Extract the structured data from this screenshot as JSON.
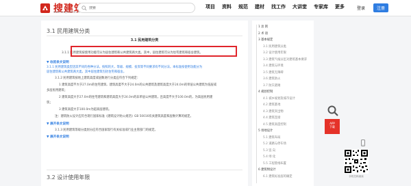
{
  "header": {
    "logo_text": "搜建筑",
    "logo_sub": "www.soujianzhu.cn",
    "search_placeholder": "搜索",
    "nav": [
      "项目",
      "资料",
      "规范",
      "建材",
      "找工作",
      "大讲堂",
      "专家库",
      "更多"
    ],
    "login_label": "登录",
    "register_label": "注册"
  },
  "main": {
    "section_title": "3.1 民用建筑分类",
    "sub_title": "3.1 民用建筑分类",
    "clause_311": "3.1.1 民用建筑按使用功能可分为居住建筑和公共建筑两大类。其中，居住建筑可分为住宅建筑和宿舍建筑。",
    "toggle_1": "▼ 收起条文说明",
    "explain_1a": "3.1.1 民用建筑类型因其不同的各种分法，按照的大，等级、规模、投资等不同要求有不同分法，本标准按使用功能分为",
    "explain_1b": "居住建筑和公共建筑两大类，其中居住建筑包括住宅和宿舍。",
    "clause_312": "3.1.2 民用建筑按地上建筑高度或层数进行分类应符合下列规定：",
    "item_1a": "1 建筑高度不大于27.0m的住宅建筑、建筑高度不大于24.0m的公共建筑及建筑高度大于24.0m的单层公共建筑为低层或",
    "item_1b": "多层民用建筑；",
    "item_2a": "2 建筑高度大于27.0m的住宅建筑和建筑高度大于24.0m的非单层公共建筑，且高度不大于100.0m的，为高层民用建",
    "item_2b": "筑；",
    "item_3": "3 建筑高度大于100.0m为超高层建筑。",
    "note": "注：建筑防火设计应符合现行国家标准《建筑设计防火规范》GB 50016有关建筑高度和层数计算的规定。",
    "toggle_2": "▼ 展开条文说明",
    "clause_313": "3.1.3 民用建筑等级分类划分应符合国家现行有关标准或行业主管部门的规定。",
    "toggle_3": "▼ 展开条文说明",
    "next_section": "3.2 设计使用年限"
  },
  "toc": [
    {
      "label": "1 总 则",
      "level": 1
    },
    {
      "label": "2 术 语",
      "level": 1
    },
    {
      "label": "3 基本规定",
      "level": 1
    },
    {
      "label": "3.1 民用建筑分类",
      "level": 2
    },
    {
      "label": "3.2 设计使用年限",
      "level": 2
    },
    {
      "label": "3.3 建筑气候分区对建筑基本要求",
      "level": 2
    },
    {
      "label": "3.4 建筑与环境",
      "level": 2
    },
    {
      "label": "3.5 建筑无障碍",
      "level": 2
    },
    {
      "label": "3.6 建筑防火",
      "level": 2
    },
    {
      "label": "3.7 防灾避难",
      "level": 2
    },
    {
      "label": "4 规划控制",
      "level": 1
    },
    {
      "label": "4.1 城乡规划及城市设计",
      "level": 2
    },
    {
      "label": "4.2 建筑基地",
      "level": 2
    },
    {
      "label": "4.3 建筑突出物",
      "level": 2
    },
    {
      "label": "4.4 建筑连接",
      "level": 2
    },
    {
      "label": "4.5 建筑高度控制",
      "level": 2
    },
    {
      "label": "5 场地设计",
      "level": 1
    },
    {
      "label": "5.1 建筑布局",
      "level": 2
    },
    {
      "label": "5.2 道路与停车场",
      "level": 2
    },
    {
      "label": "5.3 竖 向",
      "level": 2
    },
    {
      "label": "5.4 绿 化",
      "level": 2
    },
    {
      "label": "5.5 工程管线布置",
      "level": 2
    },
    {
      "label": "6 建筑物设计",
      "level": 1
    },
    {
      "label": "6.1 建筑标准层的确定",
      "level": 2
    }
  ],
  "side": {
    "red_card_text": "APP\n下载",
    "qr_caption": "手机扫码阅读"
  },
  "colors": {
    "brand_red": "#d2271d",
    "link_blue": "#2f7de1",
    "highlight_red": "#e0242a"
  }
}
